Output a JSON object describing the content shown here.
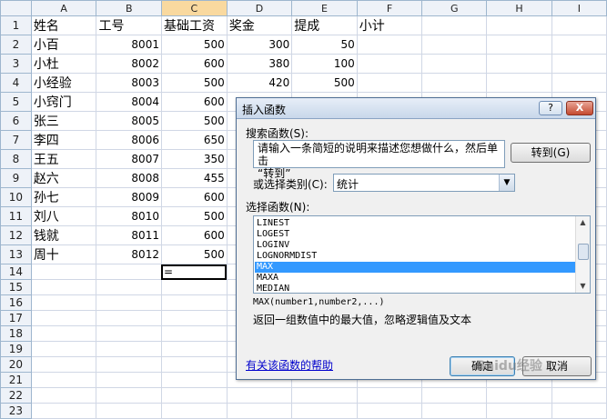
{
  "columns": [
    "A",
    "B",
    "C",
    "D",
    "E",
    "F",
    "G",
    "H",
    "I"
  ],
  "selected_column": "C",
  "rows": [
    {
      "n": "1",
      "a": "姓名",
      "b": "工号",
      "c": "基础工资",
      "d": "奖金",
      "e": "提成",
      "f": "小计"
    },
    {
      "n": "2",
      "a": "小百",
      "b": "8001",
      "c": "500",
      "d": "300",
      "e": "50",
      "f": ""
    },
    {
      "n": "3",
      "a": "小杜",
      "b": "8002",
      "c": "600",
      "d": "380",
      "e": "100",
      "f": ""
    },
    {
      "n": "4",
      "a": "小经验",
      "b": "8003",
      "c": "500",
      "d": "420",
      "e": "500",
      "f": ""
    },
    {
      "n": "5",
      "a": "小窍门",
      "b": "8004",
      "c": "600",
      "d": "300",
      "e": "200",
      "f": ""
    },
    {
      "n": "6",
      "a": "张三",
      "b": "8005",
      "c": "500",
      "d": "",
      "e": "",
      "f": ""
    },
    {
      "n": "7",
      "a": "李四",
      "b": "8006",
      "c": "650",
      "d": "",
      "e": "",
      "f": ""
    },
    {
      "n": "8",
      "a": "王五",
      "b": "8007",
      "c": "350",
      "d": "",
      "e": "",
      "f": ""
    },
    {
      "n": "9",
      "a": "赵六",
      "b": "8008",
      "c": "455",
      "d": "",
      "e": "",
      "f": ""
    },
    {
      "n": "10",
      "a": "孙七",
      "b": "8009",
      "c": "600",
      "d": "",
      "e": "",
      "f": ""
    },
    {
      "n": "11",
      "a": "刘八",
      "b": "8010",
      "c": "500",
      "d": "",
      "e": "",
      "f": ""
    },
    {
      "n": "12",
      "a": "钱就",
      "b": "8011",
      "c": "600",
      "d": "",
      "e": "",
      "f": ""
    },
    {
      "n": "13",
      "a": "周十",
      "b": "8012",
      "c": "500",
      "d": "",
      "e": "",
      "f": ""
    },
    {
      "n": "14",
      "a": "",
      "b": "",
      "c": "=",
      "d": "",
      "e": "",
      "f": ""
    },
    {
      "n": "15",
      "a": "",
      "b": "",
      "c": "",
      "d": "",
      "e": "",
      "f": ""
    },
    {
      "n": "16",
      "a": "",
      "b": "",
      "c": "",
      "d": "",
      "e": "",
      "f": ""
    },
    {
      "n": "17",
      "a": "",
      "b": "",
      "c": "",
      "d": "",
      "e": "",
      "f": ""
    },
    {
      "n": "18",
      "a": "",
      "b": "",
      "c": "",
      "d": "",
      "e": "",
      "f": ""
    },
    {
      "n": "19",
      "a": "",
      "b": "",
      "c": "",
      "d": "",
      "e": "",
      "f": ""
    },
    {
      "n": "20",
      "a": "",
      "b": "",
      "c": "",
      "d": "",
      "e": "",
      "f": ""
    },
    {
      "n": "21",
      "a": "",
      "b": "",
      "c": "",
      "d": "",
      "e": "",
      "f": ""
    },
    {
      "n": "22",
      "a": "",
      "b": "",
      "c": "",
      "d": "",
      "e": "",
      "f": ""
    },
    {
      "n": "23",
      "a": "",
      "b": "",
      "c": "",
      "d": "",
      "e": "",
      "f": ""
    }
  ],
  "dialog": {
    "title": "插入函数",
    "help_btn": "?",
    "close_btn": "X",
    "search_label": "搜索函数(S):",
    "search_text_line1": "请输入一条简短的说明来描述您想做什么，然后单击",
    "search_text_line2": "“转到”",
    "goto_btn": "转到(G)",
    "category_label": "或选择类别(C):",
    "category_value": "统计",
    "function_label": "选择函数(N):",
    "functions": [
      "LINEST",
      "LOGEST",
      "LOGINV",
      "LOGNORMDIST",
      "MAX",
      "MAXA",
      "MEDIAN"
    ],
    "selected_function": "MAX",
    "signature": "MAX(number1,number2,...)",
    "description": "返回一组数值中的最大值，忽略逻辑值及文本",
    "help_link": "有关该函数的帮助",
    "ok_btn": "确定",
    "cancel_btn": "取消"
  },
  "watermark": "Baidu经验",
  "colors": {
    "header_bg": "#eef2f8",
    "selected_header": "#f9d99f",
    "grid_line": "#d0d7e5",
    "list_selection": "#3399ff",
    "link": "#0000cc"
  }
}
